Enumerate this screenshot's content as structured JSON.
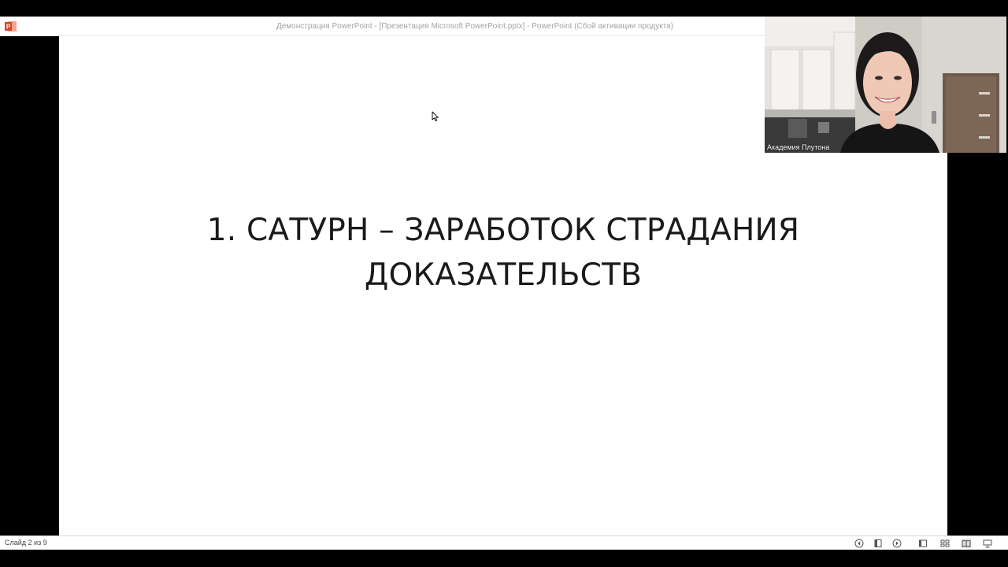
{
  "window": {
    "title": "Демонстрация PowerPoint - [Презентация Microsoft PowerPoint.pptx] - PowerPoint (Сбой активации продукта)",
    "app_icon": "powerpoint-icon"
  },
  "slide": {
    "title_line1": "1. САТУРН – ЗАРАБОТОК СТРАДАНИЯ",
    "title_line2": "ДОКАЗАТЕЛЬСТВ"
  },
  "video": {
    "participant_name": "Академия Плутона"
  },
  "statusbar": {
    "slide_counter": "Слайд 2 из 9",
    "buttons": [
      "previous-slide-icon",
      "slide-menu-icon",
      "next-slide-icon",
      "normal-view-icon",
      "slide-sorter-icon",
      "reading-view-icon",
      "slideshow-icon"
    ]
  },
  "colors": {
    "powerpoint_brand": "#d24726",
    "letterbox": "#000000",
    "slide_background": "#ffffff",
    "title_text": "#1a1a1a",
    "window_title_text": "#a3a3a3"
  }
}
